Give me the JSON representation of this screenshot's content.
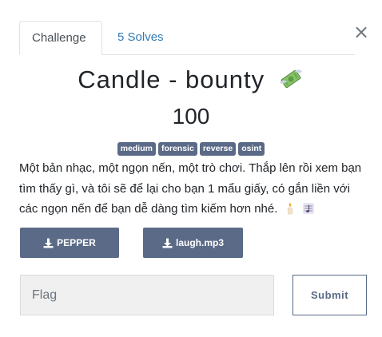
{
  "tabs": [
    {
      "label": "Challenge"
    },
    {
      "label": "5 Solves"
    }
  ],
  "close_label": "×",
  "challenge": {
    "name": "Candle - bounty",
    "value": "100",
    "tags": [
      "medium",
      "forensic",
      "reverse",
      "osint"
    ],
    "description": "Một bản nhạc, một ngọn nến, một trò chơi. Thắp lên rồi xem bạn tìm thấy gì, và tôi sẽ để lại cho bạn 1 mẩu giấy, có gắn liền với các ngọn nến để bạn dễ dàng tìm kiếm hơn nhé."
  },
  "files": [
    {
      "label": "PEPPER"
    },
    {
      "label": "laugh.mp3"
    }
  ],
  "flag_input": {
    "placeholder": "Flag"
  },
  "submit_label": "Submit",
  "icons": {
    "title_icon": "money-with-wings-icon",
    "file_icon": "download-icon",
    "desc_icons": [
      "candle-icon",
      "music-score-icon"
    ]
  },
  "colors": {
    "accent": "#5a6a87",
    "link": "#337ab7"
  }
}
